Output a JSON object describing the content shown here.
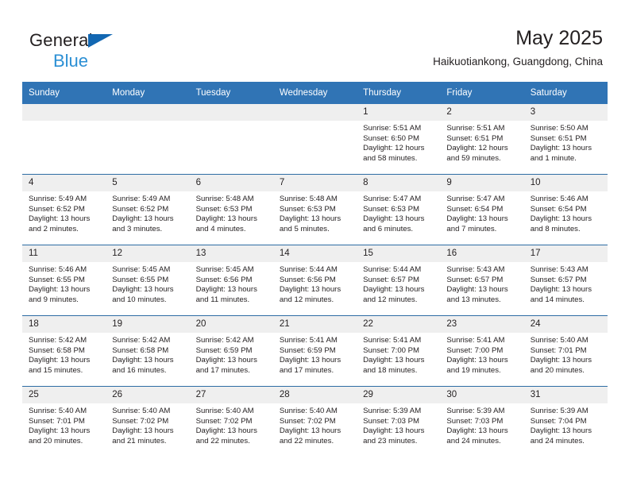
{
  "brand": {
    "line1": "General",
    "line2": "Blue",
    "flag_color": "#1267b2",
    "line2_color": "#2b8fd4"
  },
  "header": {
    "title": "May 2025",
    "subtitle": "Haikuotiankong, Guangdong, China"
  },
  "colors": {
    "header_blue": "#3074b5",
    "row_divider": "#2e6da4",
    "daynum_band": "#efefef",
    "text": "#231f20"
  },
  "calendar": {
    "weekdays": [
      "Sunday",
      "Monday",
      "Tuesday",
      "Wednesday",
      "Thursday",
      "Friday",
      "Saturday"
    ],
    "weeks": [
      [
        {
          "day": "",
          "empty": true
        },
        {
          "day": "",
          "empty": true
        },
        {
          "day": "",
          "empty": true
        },
        {
          "day": "",
          "empty": true
        },
        {
          "day": "1",
          "sunrise": "Sunrise: 5:51 AM",
          "sunset": "Sunset: 6:50 PM",
          "daylight": "Daylight: 12 hours and 58 minutes."
        },
        {
          "day": "2",
          "sunrise": "Sunrise: 5:51 AM",
          "sunset": "Sunset: 6:51 PM",
          "daylight": "Daylight: 12 hours and 59 minutes."
        },
        {
          "day": "3",
          "sunrise": "Sunrise: 5:50 AM",
          "sunset": "Sunset: 6:51 PM",
          "daylight": "Daylight: 13 hours and 1 minute."
        }
      ],
      [
        {
          "day": "4",
          "sunrise": "Sunrise: 5:49 AM",
          "sunset": "Sunset: 6:52 PM",
          "daylight": "Daylight: 13 hours and 2 minutes."
        },
        {
          "day": "5",
          "sunrise": "Sunrise: 5:49 AM",
          "sunset": "Sunset: 6:52 PM",
          "daylight": "Daylight: 13 hours and 3 minutes."
        },
        {
          "day": "6",
          "sunrise": "Sunrise: 5:48 AM",
          "sunset": "Sunset: 6:53 PM",
          "daylight": "Daylight: 13 hours and 4 minutes."
        },
        {
          "day": "7",
          "sunrise": "Sunrise: 5:48 AM",
          "sunset": "Sunset: 6:53 PM",
          "daylight": "Daylight: 13 hours and 5 minutes."
        },
        {
          "day": "8",
          "sunrise": "Sunrise: 5:47 AM",
          "sunset": "Sunset: 6:53 PM",
          "daylight": "Daylight: 13 hours and 6 minutes."
        },
        {
          "day": "9",
          "sunrise": "Sunrise: 5:47 AM",
          "sunset": "Sunset: 6:54 PM",
          "daylight": "Daylight: 13 hours and 7 minutes."
        },
        {
          "day": "10",
          "sunrise": "Sunrise: 5:46 AM",
          "sunset": "Sunset: 6:54 PM",
          "daylight": "Daylight: 13 hours and 8 minutes."
        }
      ],
      [
        {
          "day": "11",
          "sunrise": "Sunrise: 5:46 AM",
          "sunset": "Sunset: 6:55 PM",
          "daylight": "Daylight: 13 hours and 9 minutes."
        },
        {
          "day": "12",
          "sunrise": "Sunrise: 5:45 AM",
          "sunset": "Sunset: 6:55 PM",
          "daylight": "Daylight: 13 hours and 10 minutes."
        },
        {
          "day": "13",
          "sunrise": "Sunrise: 5:45 AM",
          "sunset": "Sunset: 6:56 PM",
          "daylight": "Daylight: 13 hours and 11 minutes."
        },
        {
          "day": "14",
          "sunrise": "Sunrise: 5:44 AM",
          "sunset": "Sunset: 6:56 PM",
          "daylight": "Daylight: 13 hours and 12 minutes."
        },
        {
          "day": "15",
          "sunrise": "Sunrise: 5:44 AM",
          "sunset": "Sunset: 6:57 PM",
          "daylight": "Daylight: 13 hours and 12 minutes."
        },
        {
          "day": "16",
          "sunrise": "Sunrise: 5:43 AM",
          "sunset": "Sunset: 6:57 PM",
          "daylight": "Daylight: 13 hours and 13 minutes."
        },
        {
          "day": "17",
          "sunrise": "Sunrise: 5:43 AM",
          "sunset": "Sunset: 6:57 PM",
          "daylight": "Daylight: 13 hours and 14 minutes."
        }
      ],
      [
        {
          "day": "18",
          "sunrise": "Sunrise: 5:42 AM",
          "sunset": "Sunset: 6:58 PM",
          "daylight": "Daylight: 13 hours and 15 minutes."
        },
        {
          "day": "19",
          "sunrise": "Sunrise: 5:42 AM",
          "sunset": "Sunset: 6:58 PM",
          "daylight": "Daylight: 13 hours and 16 minutes."
        },
        {
          "day": "20",
          "sunrise": "Sunrise: 5:42 AM",
          "sunset": "Sunset: 6:59 PM",
          "daylight": "Daylight: 13 hours and 17 minutes."
        },
        {
          "day": "21",
          "sunrise": "Sunrise: 5:41 AM",
          "sunset": "Sunset: 6:59 PM",
          "daylight": "Daylight: 13 hours and 17 minutes."
        },
        {
          "day": "22",
          "sunrise": "Sunrise: 5:41 AM",
          "sunset": "Sunset: 7:00 PM",
          "daylight": "Daylight: 13 hours and 18 minutes."
        },
        {
          "day": "23",
          "sunrise": "Sunrise: 5:41 AM",
          "sunset": "Sunset: 7:00 PM",
          "daylight": "Daylight: 13 hours and 19 minutes."
        },
        {
          "day": "24",
          "sunrise": "Sunrise: 5:40 AM",
          "sunset": "Sunset: 7:01 PM",
          "daylight": "Daylight: 13 hours and 20 minutes."
        }
      ],
      [
        {
          "day": "25",
          "sunrise": "Sunrise: 5:40 AM",
          "sunset": "Sunset: 7:01 PM",
          "daylight": "Daylight: 13 hours and 20 minutes."
        },
        {
          "day": "26",
          "sunrise": "Sunrise: 5:40 AM",
          "sunset": "Sunset: 7:02 PM",
          "daylight": "Daylight: 13 hours and 21 minutes."
        },
        {
          "day": "27",
          "sunrise": "Sunrise: 5:40 AM",
          "sunset": "Sunset: 7:02 PM",
          "daylight": "Daylight: 13 hours and 22 minutes."
        },
        {
          "day": "28",
          "sunrise": "Sunrise: 5:40 AM",
          "sunset": "Sunset: 7:02 PM",
          "daylight": "Daylight: 13 hours and 22 minutes."
        },
        {
          "day": "29",
          "sunrise": "Sunrise: 5:39 AM",
          "sunset": "Sunset: 7:03 PM",
          "daylight": "Daylight: 13 hours and 23 minutes."
        },
        {
          "day": "30",
          "sunrise": "Sunrise: 5:39 AM",
          "sunset": "Sunset: 7:03 PM",
          "daylight": "Daylight: 13 hours and 24 minutes."
        },
        {
          "day": "31",
          "sunrise": "Sunrise: 5:39 AM",
          "sunset": "Sunset: 7:04 PM",
          "daylight": "Daylight: 13 hours and 24 minutes."
        }
      ]
    ]
  }
}
